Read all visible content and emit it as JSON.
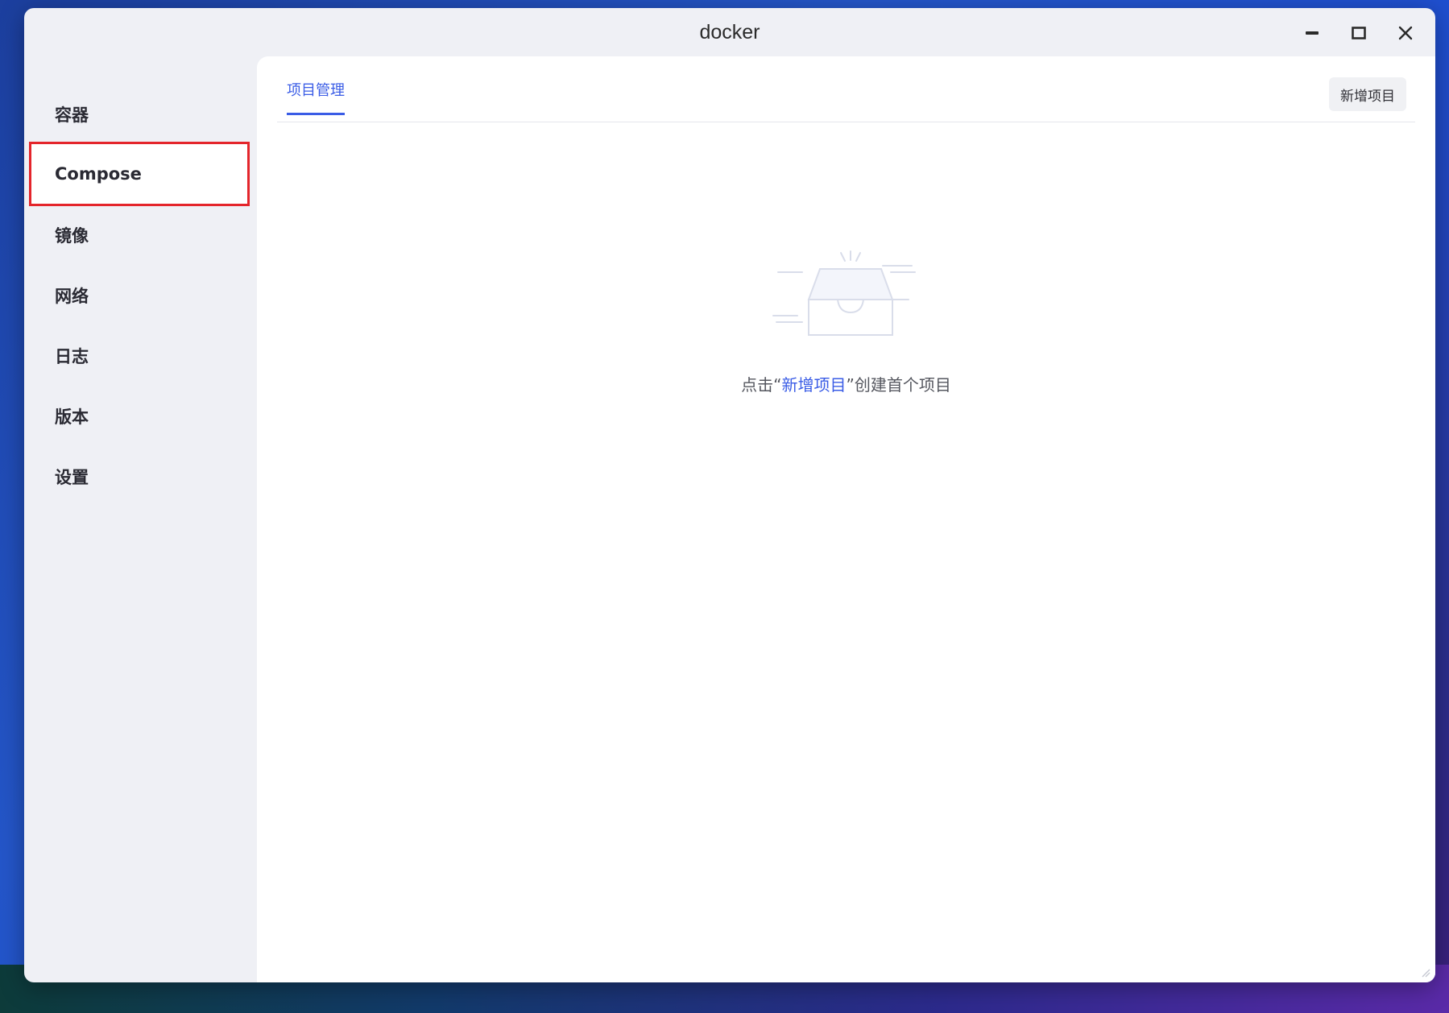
{
  "window": {
    "title": "docker",
    "controls": {
      "minimize_icon": "minimize-icon",
      "maximize_icon": "maximize-icon",
      "close_icon": "close-icon"
    }
  },
  "sidebar": {
    "items": [
      {
        "label": "容器",
        "active": false
      },
      {
        "label": "Compose",
        "active": true
      },
      {
        "label": "镜像",
        "active": false
      },
      {
        "label": "网络",
        "active": false
      },
      {
        "label": "日志",
        "active": false
      },
      {
        "label": "版本",
        "active": false
      },
      {
        "label": "设置",
        "active": false
      }
    ]
  },
  "main": {
    "tabs": [
      {
        "label": "项目管理",
        "active": true
      }
    ],
    "add_button_label": "新增项目",
    "empty_state": {
      "icon": "empty-inbox-icon",
      "prefix": "点击“",
      "link": "新增项目",
      "suffix": "”创建首个项目"
    }
  },
  "colors": {
    "accent": "#3a5ce6",
    "highlight_border": "#e4252b"
  }
}
